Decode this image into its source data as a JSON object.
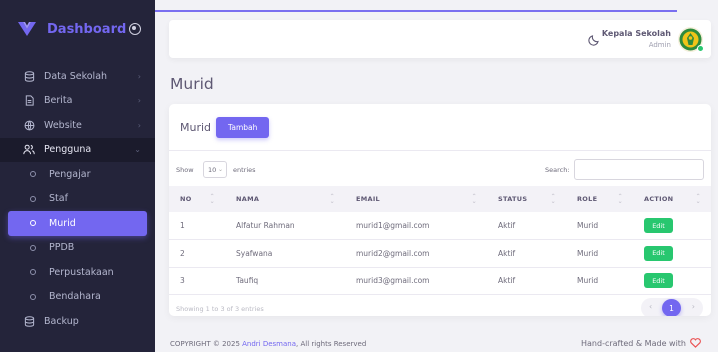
{
  "brand": {
    "title": "Dashboard"
  },
  "sidebar": {
    "items": [
      {
        "label": "Data Sekolah",
        "icon": "database-icon",
        "chevron": "›"
      },
      {
        "label": "Berita",
        "icon": "file-icon",
        "chevron": "›"
      },
      {
        "label": "Website",
        "icon": "globe-icon",
        "chevron": "›"
      },
      {
        "label": "Pengguna",
        "icon": "users-icon",
        "chevron": "⌄"
      },
      {
        "label": "Pengajar"
      },
      {
        "label": "Staf"
      },
      {
        "label": "Murid"
      },
      {
        "label": "PPDB"
      },
      {
        "label": "Perpustakaan"
      },
      {
        "label": "Bendahara"
      },
      {
        "label": "Backup",
        "icon": "database-icon"
      }
    ]
  },
  "navbar": {
    "user_name": "Kepala Sekolah",
    "user_role": "Admin"
  },
  "page": {
    "title": "Murid"
  },
  "card": {
    "title": "Murid",
    "add_button": "Tambah",
    "show_label": "Show",
    "page_length": "10",
    "entries_label": "entries",
    "search_label": "Search:",
    "search_value": "",
    "info": "Showing 1 to 3 of 3 entries",
    "pagination": {
      "prev": "‹",
      "current": "1",
      "next": "›"
    }
  },
  "table": {
    "columns": [
      "NO",
      "NAMA",
      "EMAIL",
      "STATUS",
      "ROLE",
      "ACTION"
    ],
    "rows": [
      {
        "no": "1",
        "nama": "Alfatur Rahman",
        "email": "murid1@gmail.com",
        "status": "Aktif",
        "role": "Murid",
        "action": "Edit"
      },
      {
        "no": "2",
        "nama": "Syafwana",
        "email": "murid2@gmail.com",
        "status": "Aktif",
        "role": "Murid",
        "action": "Edit"
      },
      {
        "no": "3",
        "nama": "Taufiq",
        "email": "murid3@gmail.com",
        "status": "Aktif",
        "role": "Murid",
        "action": "Edit"
      }
    ]
  },
  "footer": {
    "copyright_prefix": "COPYRIGHT © 2025 ",
    "author": "Andri Desmana",
    "copyright_suffix": ", All rights Reserved",
    "made_with": "Hand-crafted & Made with"
  },
  "colors": {
    "accent": "#7367f0",
    "sidebar_bg": "#24243a",
    "success": "#28c76f",
    "heart": "#ea5455"
  }
}
